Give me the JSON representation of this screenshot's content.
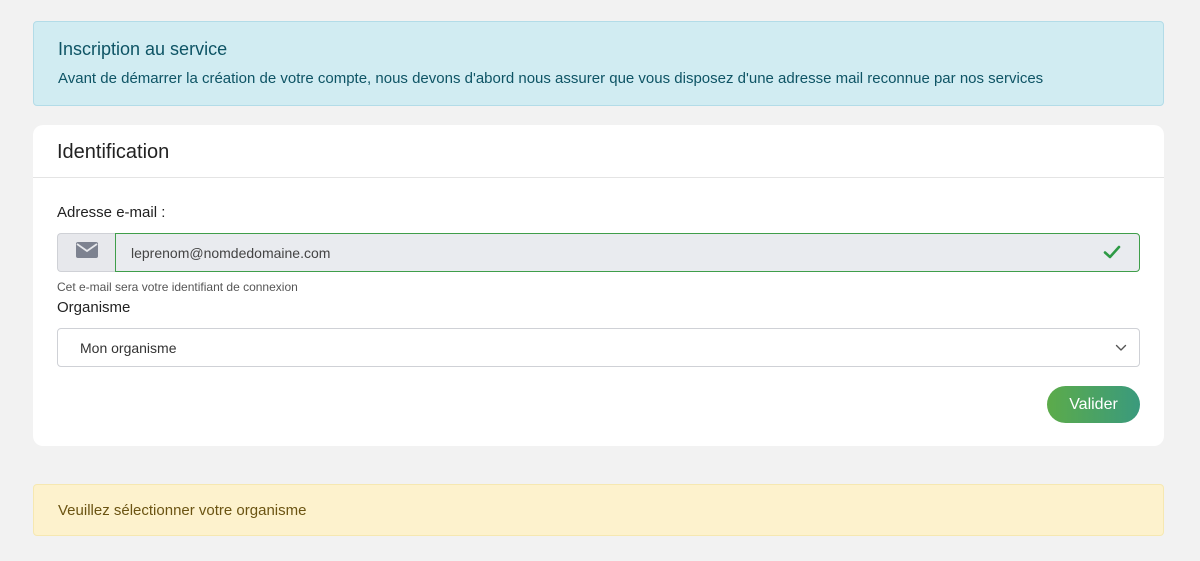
{
  "info_alert": {
    "title": "Inscription au service",
    "description": "Avant de démarrer la création de votre compte, nous devons d'abord nous assurer que vous disposez d'une adresse mail reconnue par nos services"
  },
  "card": {
    "title": "Identification",
    "email": {
      "label": "Adresse e-mail :",
      "value": "leprenom@nomdedomaine.com",
      "icon": "envelope-icon",
      "status_icon": "checkmark-icon",
      "hint": "Cet e-mail sera votre identifiant de connexion"
    },
    "organisation": {
      "label": "Organisme",
      "selected": "Mon organisme",
      "icon": "chevron-down-icon"
    },
    "submit_label": "Valider"
  },
  "warning_alert": {
    "message": "Veuillez sélectionner votre organisme"
  },
  "colors": {
    "info_bg": "#d1ecf2",
    "warning_bg": "#fdf2cd",
    "valid_border": "#3f9e4a",
    "button_gradient_start": "#5cab4a",
    "button_gradient_end": "#3a9a7d"
  }
}
